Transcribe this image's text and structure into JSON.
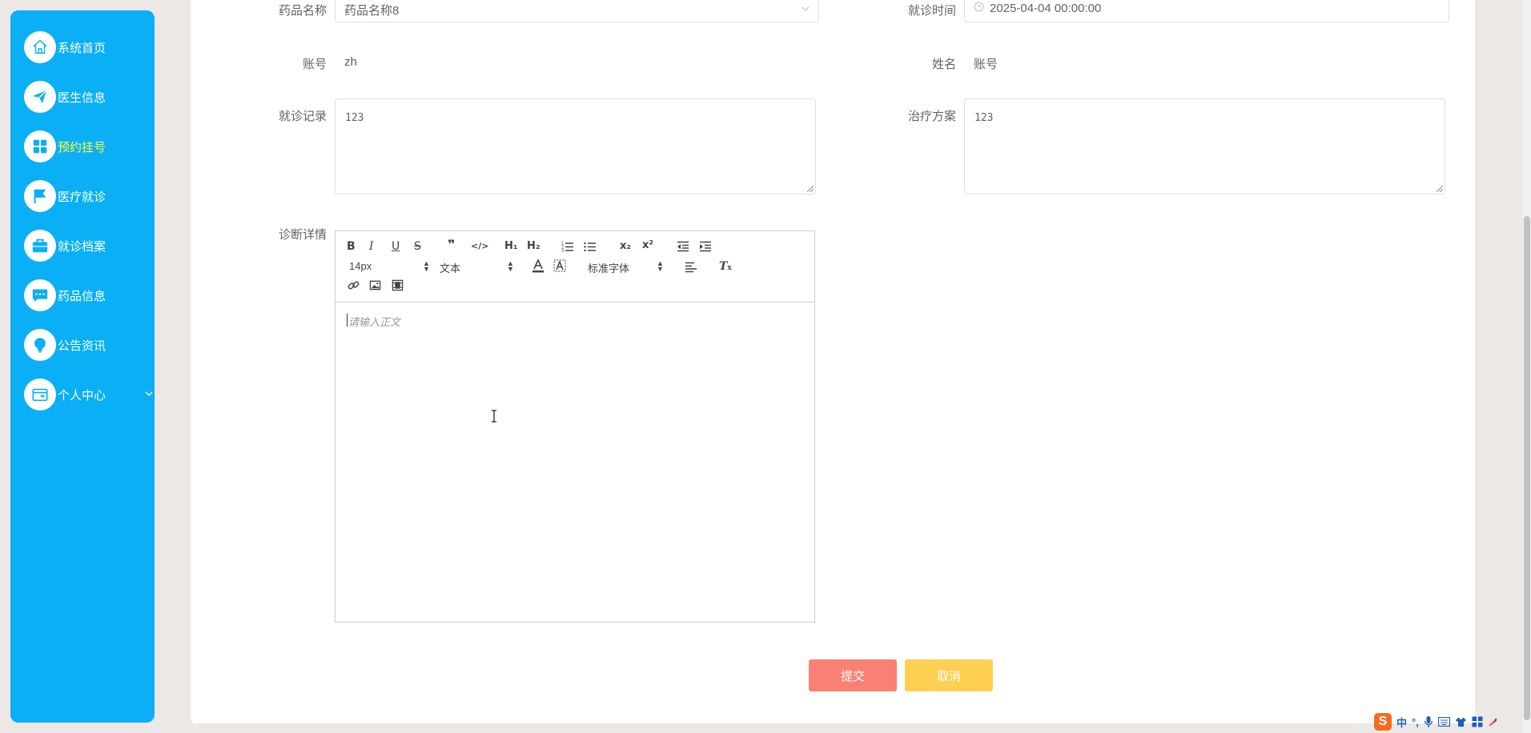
{
  "sidebar": {
    "items": [
      {
        "label": "系统首页",
        "icon": "home-icon"
      },
      {
        "label": "医生信息",
        "icon": "send-icon"
      },
      {
        "label": "预约挂号",
        "icon": "grid-icon",
        "active": true
      },
      {
        "label": "医疗就诊",
        "icon": "flag-icon"
      },
      {
        "label": "就诊档案",
        "icon": "briefcase-icon"
      },
      {
        "label": "药品信息",
        "icon": "chat-icon"
      },
      {
        "label": "公告资讯",
        "icon": "bulb-icon"
      },
      {
        "label": "个人中心",
        "icon": "card-icon"
      }
    ]
  },
  "form": {
    "drug_name_label": "药品名称",
    "drug_name_value": "药品名称8",
    "visit_time_label": "就诊时间",
    "visit_time_value": "2025-04-04 00:00:00",
    "account_label": "账号",
    "account_value": "zh",
    "name_label": "姓名",
    "name_value": "账号",
    "visit_record_label": "就诊记录",
    "visit_record_value": "123",
    "treatment_label": "治疗方案",
    "treatment_value": "123",
    "diagnosis_label": "诊断详情",
    "editor_placeholder": "请输入正文",
    "font_size": "14px",
    "header_picker": "文本",
    "font_family": "标准字体"
  },
  "buttons": {
    "submit": "提交",
    "cancel": "取消"
  },
  "tray": {
    "ime_logo": "S",
    "ime_mode": "中"
  },
  "colors": {
    "sidebar": "#0aaff5",
    "active_nav": "#ffff3a",
    "submit": "#fb8074",
    "cancel": "#ffcf52"
  }
}
